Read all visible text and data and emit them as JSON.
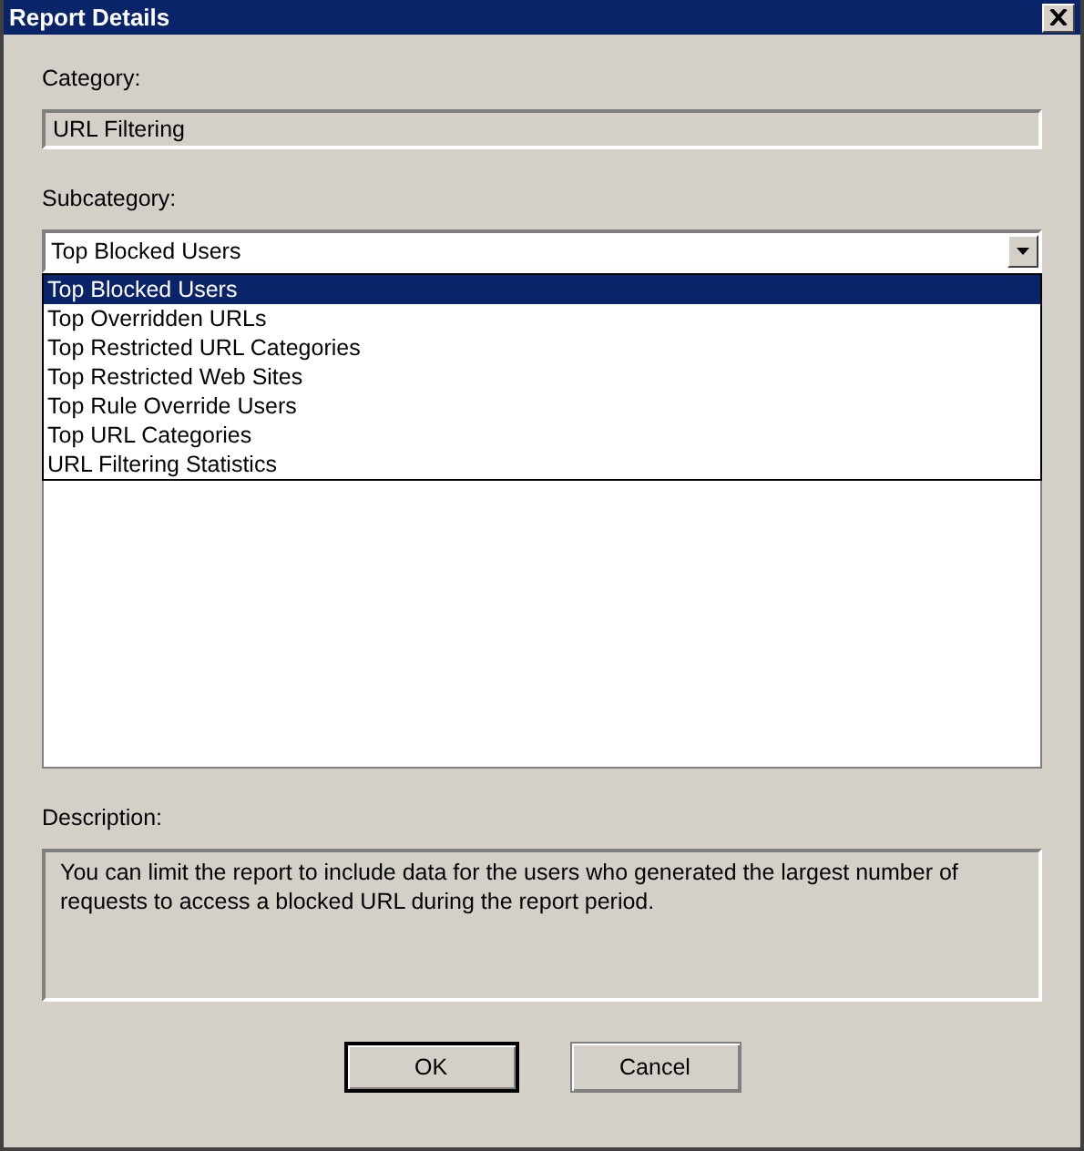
{
  "window": {
    "title": "Report Details"
  },
  "category": {
    "label": "Category:",
    "value": "URL Filtering"
  },
  "subcategory": {
    "label": "Subcategory:",
    "value": "Top Blocked Users",
    "expanded": true,
    "options": [
      {
        "label": "Top Blocked Users",
        "selected": true
      },
      {
        "label": "Top Overridden URLs",
        "selected": false
      },
      {
        "label": "Top Restricted URL Categories",
        "selected": false
      },
      {
        "label": "Top Restricted Web Sites",
        "selected": false
      },
      {
        "label": "Top Rule Override Users",
        "selected": false
      },
      {
        "label": "Top URL Categories",
        "selected": false
      },
      {
        "label": "URL Filtering Statistics",
        "selected": false
      }
    ]
  },
  "description": {
    "label": "Description:",
    "text": "You can limit the report to include data for the users who generated the largest number of requests to access a blocked URL during the report period."
  },
  "buttons": [
    {
      "label": "OK",
      "default": true
    },
    {
      "label": "Cancel",
      "default": false
    }
  ]
}
